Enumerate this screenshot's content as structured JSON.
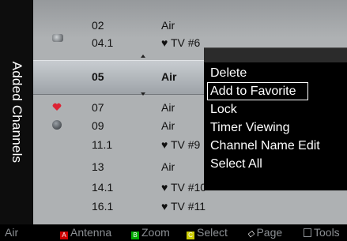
{
  "side_title": "Added Channels",
  "channels": [
    {
      "number": "02",
      "name": "Air"
    },
    {
      "number": "04.1",
      "name": "♥ TV #6"
    },
    {
      "number": "05",
      "name": "Air"
    },
    {
      "number": "07",
      "name": "Air"
    },
    {
      "number": "09",
      "name": "Air"
    },
    {
      "number": "11.1",
      "name": "♥ TV #9"
    },
    {
      "number": "13",
      "name": "Air"
    },
    {
      "number": "14.1",
      "name": "♥ TV #10"
    },
    {
      "number": "16.1",
      "name": "♥ TV #11"
    }
  ],
  "menu": {
    "items": [
      "Delete",
      "Add to Favorite",
      "Lock",
      "Timer Viewing",
      "Channel Name Edit",
      "Select All"
    ],
    "highlighted": "Add to Favorite"
  },
  "footer": {
    "mode": "Air",
    "a_label": "Antenna",
    "b_label": "Zoom",
    "c_label": "Select",
    "page_label": "Page",
    "tools_label": "Tools"
  },
  "colors": {
    "key_a": "#c00000",
    "key_b": "#00a000",
    "key_c": "#cccc00",
    "selected_row": "#b0b4b8"
  }
}
